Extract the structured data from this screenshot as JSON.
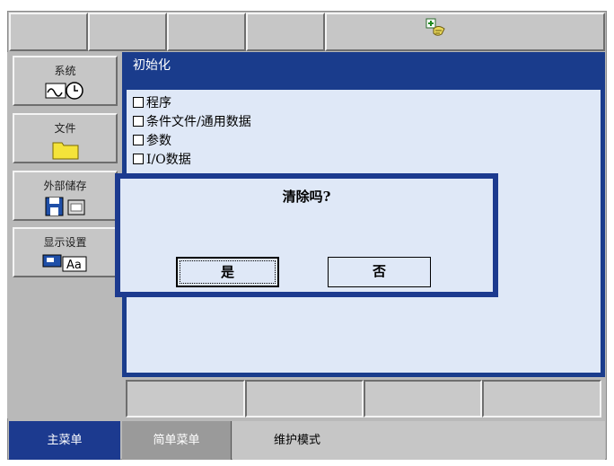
{
  "top_bar": {
    "status_icon": "teach-pendant-icon"
  },
  "sidebar": {
    "items": [
      {
        "label": "系统",
        "icon": "system-wave-clock-icon"
      },
      {
        "label": "文件",
        "icon": "folder-icon"
      },
      {
        "label": "外部储存",
        "icon": "floppy-card-icon"
      },
      {
        "label": "显示设置",
        "icon": "display-font-icon"
      }
    ]
  },
  "panel": {
    "title": "初始化",
    "items": [
      "程序",
      "条件文件/通用数据",
      "参数",
      "I/O数据"
    ]
  },
  "dialog": {
    "message": "清除吗?",
    "yes_label": "是",
    "no_label": "否"
  },
  "bottom_tabs": {
    "main_menu": "主菜单",
    "simple_menu": "简单菜单",
    "mode": "维护模式"
  },
  "colors": {
    "accent": "#1a3c8c",
    "tab_active": "#1c3a8f",
    "panel_bg": "#dfe8f7"
  }
}
